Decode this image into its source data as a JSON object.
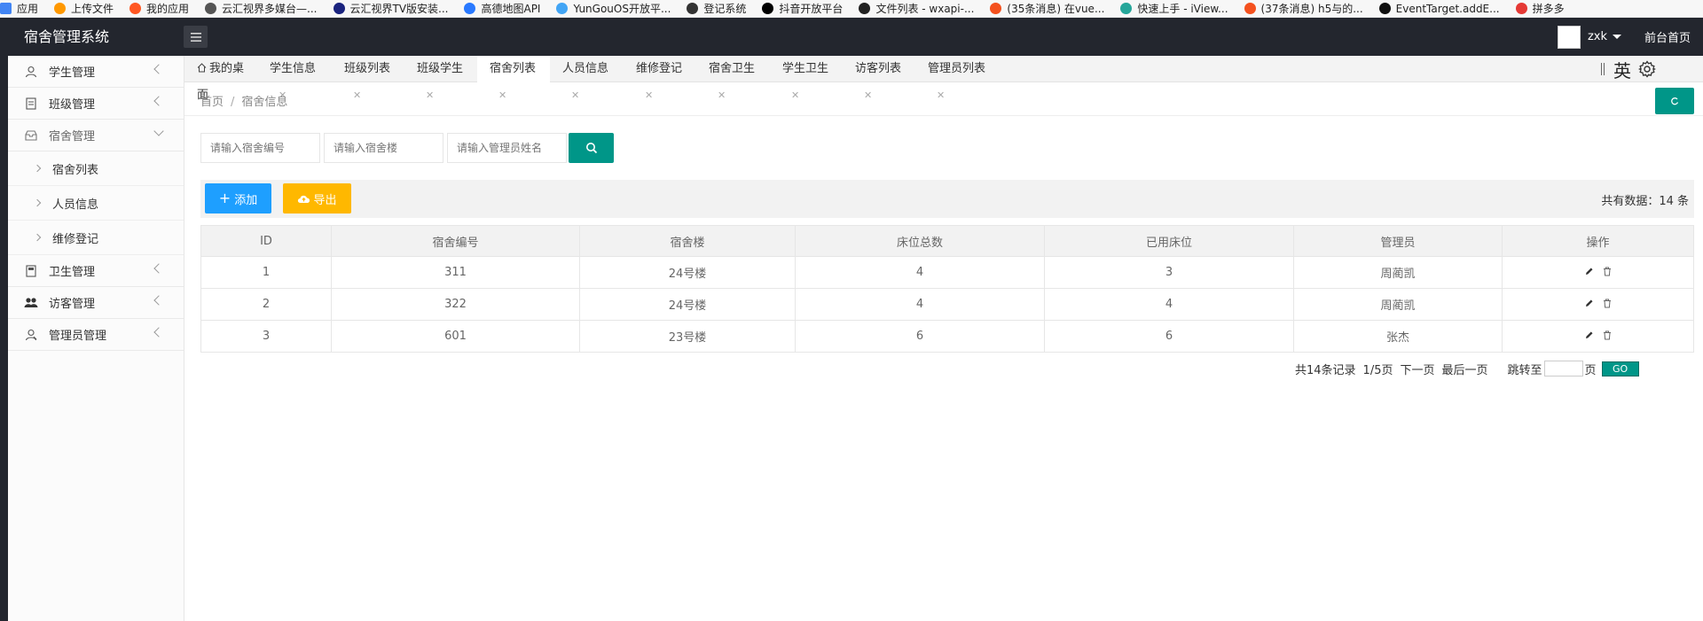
{
  "bookmarks": [
    {
      "label": "应用",
      "color": "#4285f4"
    },
    {
      "label": "上传文件",
      "color": "#ff9800"
    },
    {
      "label": "我的应用",
      "color": "#ff5722"
    },
    {
      "label": "云汇视界多媒台—...",
      "color": "#555555"
    },
    {
      "label": "云汇视界TV版安装...",
      "color": "#1a237e"
    },
    {
      "label": "高德地图API",
      "color": "#2979ff"
    },
    {
      "label": "YunGouOS开放平...",
      "color": "#42a5f5"
    },
    {
      "label": "登记系统",
      "color": "#333333"
    },
    {
      "label": "抖音开放平台",
      "color": "#000000"
    },
    {
      "label": "文件列表 - wxapi-...",
      "color": "#222222"
    },
    {
      "label": "(35条消息) 在vue...",
      "color": "#f4511e"
    },
    {
      "label": "快速上手 - iView...",
      "color": "#26a69a"
    },
    {
      "label": "(37条消息) h5与的...",
      "color": "#f4511e"
    },
    {
      "label": "EventTarget.addE...",
      "color": "#111111"
    },
    {
      "label": "拼多多",
      "color": "#e53935"
    }
  ],
  "header": {
    "title": "宿舍管理系统",
    "user": "zxk",
    "front_link": "前台首页"
  },
  "sidebar": {
    "items": [
      {
        "label": "学生管理",
        "icon": "user-icon"
      },
      {
        "label": "班级管理",
        "icon": "class-icon"
      },
      {
        "label": "宿舍管理",
        "icon": "dorm-icon"
      },
      {
        "label": "卫生管理",
        "icon": "clipboard-icon"
      },
      {
        "label": "访客管理",
        "icon": "visitors-icon"
      },
      {
        "label": "管理员管理",
        "icon": "admin-icon"
      }
    ],
    "sub_items": [
      "宿舍列表",
      "人员信息",
      "维修登记"
    ]
  },
  "tabs": [
    {
      "label": "我的桌面"
    },
    {
      "label": "学生信息"
    },
    {
      "label": "班级列表"
    },
    {
      "label": "班级学生"
    },
    {
      "label": "宿舍列表"
    },
    {
      "label": "人员信息"
    },
    {
      "label": "维修登记"
    },
    {
      "label": "宿舍卫生"
    },
    {
      "label": "学生卫生"
    },
    {
      "label": "访客列表"
    },
    {
      "label": "管理员列表"
    }
  ],
  "lang_switch": "英",
  "breadcrumb": {
    "home": "首页",
    "sep": "/",
    "current": "宿舍信息"
  },
  "search": {
    "dorm_no_placeholder": "请输入宿舍编号",
    "building_placeholder": "请输入宿舍楼",
    "manager_placeholder": "请输入管理员姓名"
  },
  "toolbar": {
    "add_label": "添加",
    "export_label": "导出",
    "total_text": "共有数据：14 条"
  },
  "table": {
    "columns": [
      "ID",
      "宿舍编号",
      "宿舍楼",
      "床位总数",
      "已用床位",
      "管理员",
      "操作"
    ],
    "rows": [
      [
        "1",
        "311",
        "24号楼",
        "4",
        "3",
        "周蔺凯"
      ],
      [
        "2",
        "322",
        "24号楼",
        "4",
        "4",
        "周蔺凯"
      ],
      [
        "3",
        "601",
        "23号楼",
        "6",
        "6",
        "张杰"
      ]
    ]
  },
  "pagination": {
    "records": "共14条记录",
    "page": "1/5页",
    "next": "下一页",
    "last": "最后一页",
    "jump": "跳转至",
    "unit": "页",
    "go": "GO"
  },
  "colors": {
    "header_bg": "#23262e",
    "primary": "#009688",
    "add_btn": "#1e9fff",
    "export_btn": "#ffb800"
  }
}
